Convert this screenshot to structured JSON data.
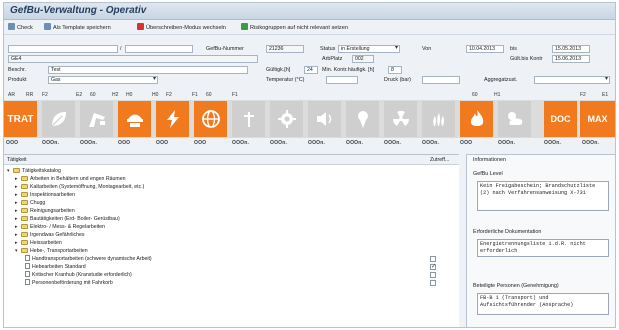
{
  "window": {
    "title": "GefBu-Verwaltung - Operativ"
  },
  "toolbar": {
    "check": "Check",
    "save_template": "Als Template speichern",
    "overwrite_mode": "Überschreiben-Modus wechseln",
    "risk_groups": "Risikogruppen auf nicht relevant setzen"
  },
  "form": {
    "slash": "/",
    "id_value": "GE4",
    "gefbu_label": "GefBu-Nummer",
    "gefbu_value": "21236",
    "status_label": "Status",
    "status_value": "in Erstellung",
    "arbplatz_label": "ArbPlatz",
    "arbplatz_value": "002",
    "von_label": "Von",
    "von_value": "10.04.2013",
    "bis_label": "bis",
    "bis_value": "15.05.2013",
    "gueltig_label": "Gült.bis Kontr",
    "gueltig_value": "15.06.2013",
    "beschr_label": "Beschr.",
    "beschr_value": "Test",
    "produkt_label": "Produkt",
    "produkt_value": "Gas",
    "guelt_label": "Gültigk.[h]",
    "guelt_value": "24",
    "minkontr_label": "Min. Kontr.häufigk. [h]",
    "minkontr_value": "8",
    "temp_label": "Temperatur (°C)",
    "druck_label": "Druck (bar)",
    "aggr_label": "Aggregatzust."
  },
  "strip": {
    "header_labels": [
      "AR",
      "RR",
      "F2",
      "E2",
      "60",
      "H2",
      "H0",
      "H0",
      "F2",
      "F1",
      "60",
      "F1",
      "60",
      "H1",
      "F2",
      "E1"
    ],
    "tiles": [
      {
        "label": "TRAT",
        "icon": "trat-text-tile",
        "color": "orange"
      },
      {
        "label": "",
        "icon": "leaf-icon",
        "color": "grey"
      },
      {
        "label": "",
        "icon": "crane-icon",
        "color": "grey"
      },
      {
        "label": "",
        "icon": "hardhat-icon",
        "color": "orange"
      },
      {
        "label": "",
        "icon": "lightning-icon",
        "color": "orange"
      },
      {
        "label": "",
        "icon": "globe-icon",
        "color": "orange"
      },
      {
        "label": "",
        "icon": "antenna-icon",
        "color": "grey"
      },
      {
        "label": "",
        "icon": "gear-icon",
        "color": "grey"
      },
      {
        "label": "",
        "icon": "speaker-icon",
        "color": "grey"
      },
      {
        "label": "",
        "icon": "pin-icon",
        "color": "grey"
      },
      {
        "label": "",
        "icon": "radiation-icon",
        "color": "grey"
      },
      {
        "label": "",
        "icon": "heat-icon",
        "color": "grey"
      },
      {
        "label": "",
        "icon": "fire-icon",
        "color": "orange"
      },
      {
        "label": "",
        "icon": "weather-icon",
        "color": "grey"
      },
      {
        "label": "DOC",
        "icon": "doc-text-tile",
        "color": "orange"
      },
      {
        "label": "MAX",
        "icon": "max-text-tile",
        "color": "orange"
      }
    ],
    "status_texts": [
      "OOO",
      "OOOn.",
      "OOOn.",
      "OOO",
      "OOO",
      "OOO",
      "OOOn.",
      "OOOn.",
      "OOOn.",
      "OOOn.",
      "OOOn.",
      "OOOn.",
      "OOO",
      "OOOn.",
      "OOOn.",
      "OOOn."
    ]
  },
  "tree": {
    "col_task": "Tätigkeit",
    "col_zutreff": "Zutreff...",
    "root": "Tätigkeitskatalog",
    "items": [
      "Arbeiten in Behältern und engen Räumen",
      "Kaltarbeiten (Systemöffnung, Montagearbeit, etc.)",
      "Inspektionsarbeiten",
      "Chugg",
      "Reinigungsarbeiten",
      "Bautätigkeiten (Erd- Boiler- Gerüstbau)",
      "Elektro- / Mess- & Regelarbeiten",
      "Irgendwas Gefährliches",
      "Heissarbeiten",
      "Hebe-, Transportarbeiten"
    ],
    "subitems": [
      "Handtransportarbeiten (schwere dynamische Arbeit)",
      "Hebearbeiten Standard",
      "Kritischer Kranhub (Kranstudie erforderlich)",
      "Personenbeförderung mit Fahrkorb"
    ],
    "checks": [
      false,
      true,
      false,
      false
    ]
  },
  "info": {
    "header": "Informationen",
    "level_label": "GefBu Level",
    "level_text": "Kein Freigabeschein; Brandschutzliste (2) nach Verfahrensanweisung X-731",
    "docs_label": "Erforderliche Dokumentation",
    "docs_text": "Energietrennungsliste i.d.R. nicht erforderlich",
    "persons_label": "Beteiligte Personen (Genehmigung)",
    "persons_text": "FB-B 1 (Transport) und Aufsichtsführender (Ansprache)"
  },
  "colors": {
    "accent_orange": "#f07a1d",
    "title_blue": "#253f5e"
  }
}
